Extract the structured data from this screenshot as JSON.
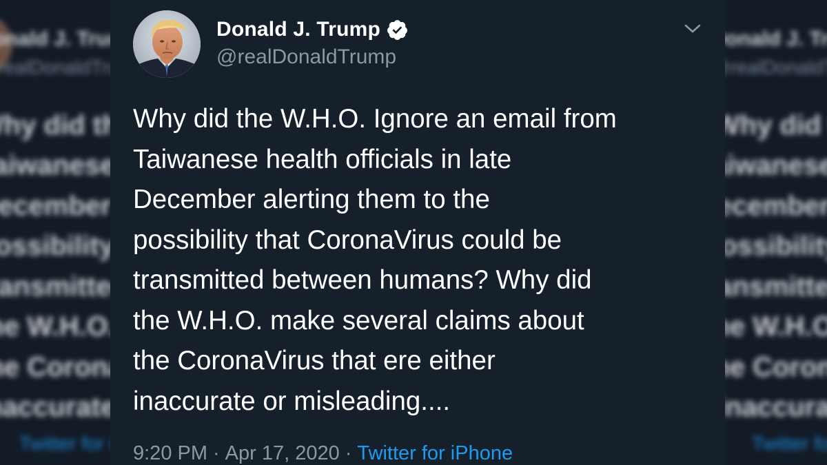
{
  "tweet": {
    "display_name": "Donald J. Trump",
    "handle": "@realDonaldTrump",
    "verified": true,
    "text_lines": [
      "Why did the W.H.O. Ignore an email from",
      "Taiwanese health officials in late",
      "December alerting them to the",
      "possibility that CoronaVirus could be",
      "transmitted between humans? Why did",
      "the W.H.O. make several claims about",
      "the CoronaVirus that ere either",
      "inaccurate or misleading...."
    ],
    "time": "9:20 PM",
    "separator": "·",
    "date": "Apr 17, 2020",
    "source": "Twitter for iPhone",
    "menu_icon": "chevron-down-icon",
    "verified_icon": "verified-badge-icon"
  },
  "colors": {
    "card_background": "#15202b",
    "text": "#ffffff",
    "secondary_text": "#8b98a5",
    "link": "#1d9bf0",
    "verified_badge": "#ffffff"
  }
}
